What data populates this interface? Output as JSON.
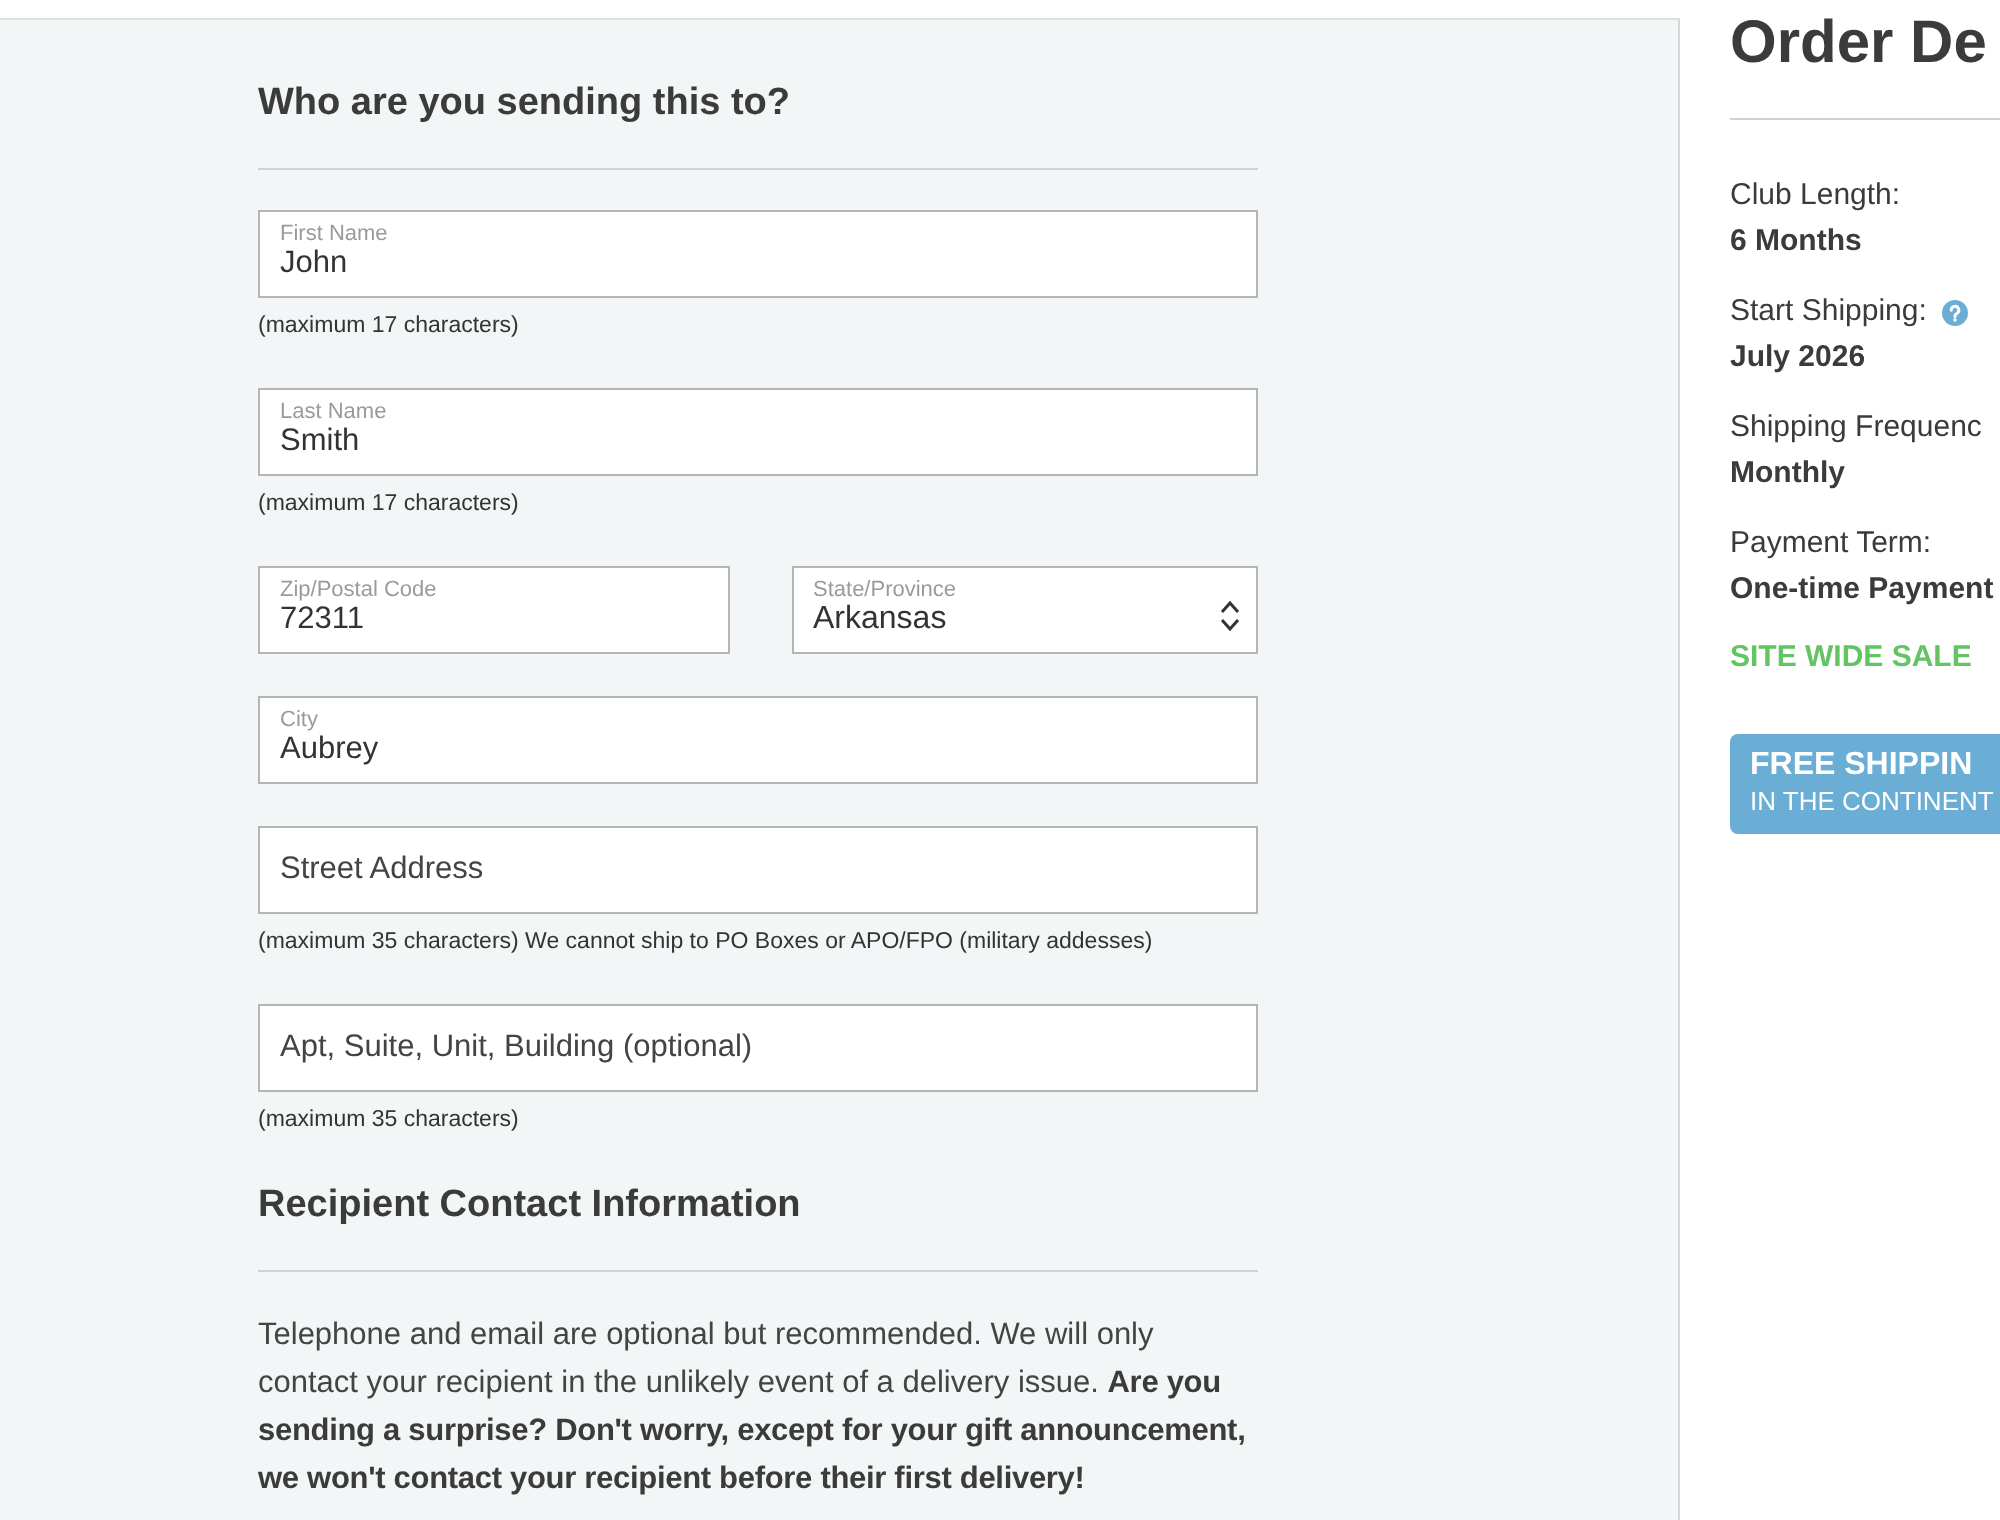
{
  "recipient_form": {
    "heading": "Who are you sending this to?",
    "rows": [
      {
        "fields": [
          {
            "kind": "text",
            "label": "First Name",
            "value": "John"
          }
        ],
        "note": "(maximum 17 characters)"
      },
      {
        "fields": [
          {
            "kind": "text",
            "label": "Last Name",
            "value": "Smith"
          }
        ],
        "note": "(maximum 17 characters)"
      },
      {
        "fields": [
          {
            "kind": "text",
            "label": "Zip/Postal Code",
            "value": "72311"
          },
          {
            "kind": "select",
            "label": "State/Province",
            "value": "Arkansas"
          }
        ]
      },
      {
        "fields": [
          {
            "kind": "text",
            "label": "City",
            "value": "Aubrey"
          }
        ]
      },
      {
        "fields": [
          {
            "kind": "text",
            "placeholder": "Street Address"
          }
        ],
        "note": "(maximum 35 characters) We cannot ship to PO Boxes or APO/FPO (military addesses)"
      },
      {
        "fields": [
          {
            "kind": "text",
            "placeholder": "Apt, Suite, Unit, Building (optional)"
          }
        ],
        "note": "(maximum 35 characters)"
      }
    ]
  },
  "contact_section": {
    "heading": "Recipient Contact Information",
    "text": "Telephone and email are optional but recommended. We will only contact your recipient in the unlikely event of a delivery issue. **Are you sending a surprise? Don't worry, except for your gift announcement, we won't contact your recipient before their first delivery!**"
  },
  "order_details": {
    "title": "Order De",
    "items": [
      {
        "label": "Club Length:",
        "value": "6 Months",
        "help": false
      },
      {
        "label": "Start Shipping:",
        "value": "July 2026",
        "help": true
      },
      {
        "label": "Shipping Frequenc",
        "value": "Monthly",
        "help": false
      },
      {
        "label": "Payment Term:",
        "value": "One-time Payment",
        "help": false
      }
    ],
    "sale": "SITE WIDE SALE",
    "banner": {
      "title": "FREE SHIPPIN",
      "subtitle": "IN THE CONTINENT"
    }
  }
}
